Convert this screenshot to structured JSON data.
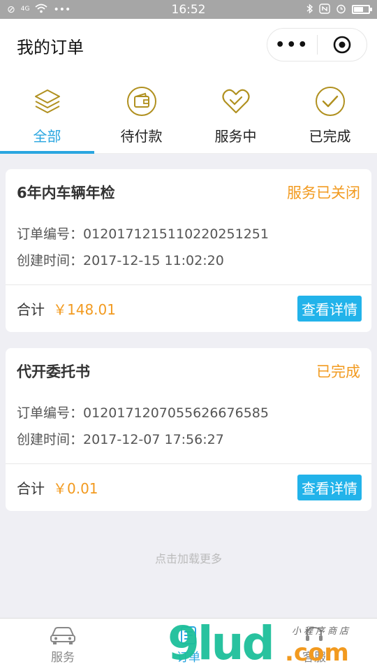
{
  "status_bar": {
    "time": "16:52",
    "left_text": "4G"
  },
  "navbar": {
    "title": "我的订单",
    "more_label": "•••"
  },
  "tabs": [
    {
      "label": "全部",
      "icon": "layers-icon",
      "active": true
    },
    {
      "label": "待付款",
      "icon": "wallet-icon",
      "active": false
    },
    {
      "label": "服务中",
      "icon": "heart-icon",
      "active": false
    },
    {
      "label": "已完成",
      "icon": "check-circle-icon",
      "active": false
    }
  ],
  "orders": [
    {
      "name": "6年内车辆年检",
      "status": "服务已关闭",
      "order_no_label": "订单编号：",
      "order_no": "0120171215110220251251",
      "created_label": "创建时间：",
      "created": "2017-12-15 11:02:20",
      "total_label": "合计",
      "amount": "￥148.01",
      "detail_label": "查看详情"
    },
    {
      "name": "代开委托书",
      "status": "已完成",
      "order_no_label": "订单编号：",
      "order_no": "0120171207055626676585",
      "created_label": "创建时间：",
      "created": "2017-12-07 17:56:27",
      "total_label": "合计",
      "amount": "￥0.01",
      "detail_label": "查看详情"
    }
  ],
  "load_more": "点击加载更多",
  "tabbar": [
    {
      "label": "服务",
      "icon": "car-icon",
      "active": false
    },
    {
      "label": "订单",
      "icon": "order-list-icon",
      "active": true
    },
    {
      "label": "客服",
      "icon": "headset-icon",
      "active": false
    }
  ],
  "watermark": {
    "brand": "9lud",
    "domain": ".com",
    "small": "小程序商店"
  },
  "colors": {
    "accent": "#2aa6e0",
    "status": "#f29a1f",
    "button": "#22b3ea",
    "icon_gold": "#b0901f"
  }
}
